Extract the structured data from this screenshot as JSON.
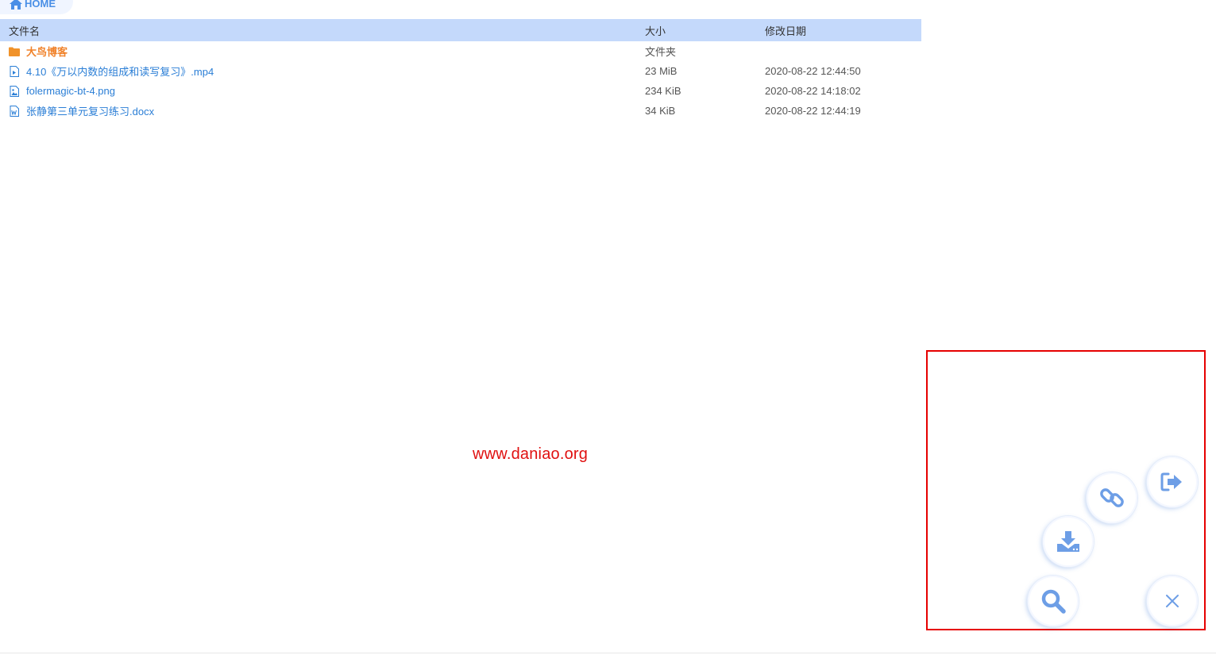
{
  "breadcrumb": {
    "home_label": "HOME"
  },
  "table": {
    "headers": {
      "name": "文件名",
      "size": "大小",
      "date": "修改日期"
    },
    "rows": [
      {
        "name": "大鸟博客",
        "size": "文件夹",
        "date": "",
        "type": "folder"
      },
      {
        "name": "4.10《万以内数的组成和读写复习》.mp4",
        "size": "23 MiB",
        "date": "2020-08-22 12:44:50",
        "type": "video"
      },
      {
        "name": "folermagic-bt-4.png",
        "size": "234 KiB",
        "date": "2020-08-22 14:18:02",
        "type": "image"
      },
      {
        "name": "张静第三单元复习练习.docx",
        "size": "34 KiB",
        "date": "2020-08-22 12:44:19",
        "type": "word"
      }
    ]
  },
  "watermark": "www.daniao.org",
  "colors": {
    "accent": "#4a8fe6",
    "header_bg": "#c4d9fb",
    "folder": "#f0822a",
    "link": "#2a7ed6",
    "highlight": "#e60000"
  },
  "fab_buttons": [
    "logout-icon",
    "link-icon",
    "download-icon",
    "search-icon",
    "close-icon"
  ]
}
